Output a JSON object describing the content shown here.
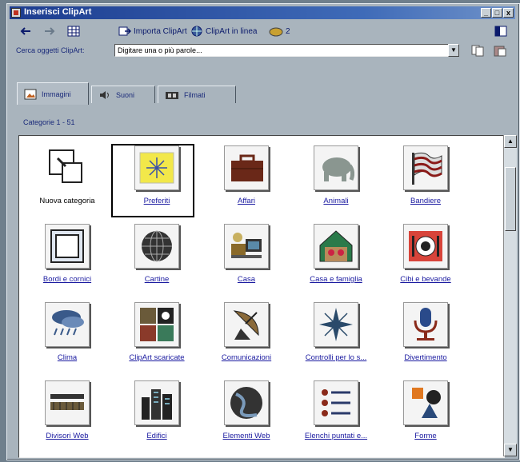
{
  "window": {
    "title": "Inserisci ClipArt",
    "controls": [
      "_",
      "□",
      "x"
    ]
  },
  "toolbar": {
    "importa": "Importa ClipArt",
    "online": "ClipArt in linea",
    "help": "2"
  },
  "search": {
    "label": "Cerca oggetti ClipArt:",
    "value": "Digitare una o più parole..."
  },
  "tabs": [
    {
      "label": "Immagini",
      "icon": "images-icon"
    },
    {
      "label": "Suoni",
      "icon": "speaker-icon"
    },
    {
      "label": "Filmati",
      "icon": "film-icon"
    }
  ],
  "categories_label": "Categorie 1 - 51",
  "categories": [
    {
      "label": "Nuova categoria",
      "icon": "new-category-icon"
    },
    {
      "label": "Preferiti",
      "icon": "star-icon"
    },
    {
      "label": "Affari",
      "icon": "briefcase-icon"
    },
    {
      "label": "Animali",
      "icon": "elephant-icon"
    },
    {
      "label": "Bandiere",
      "icon": "flag-icon"
    },
    {
      "label": "Bordi e cornici",
      "icon": "frame-icon"
    },
    {
      "label": "Cartine",
      "icon": "globe-icon"
    },
    {
      "label": "Casa",
      "icon": "home-icon"
    },
    {
      "label": "Casa e famiglia",
      "icon": "family-house-icon"
    },
    {
      "label": "Cibi e bevande",
      "icon": "plate-icon"
    },
    {
      "label": "Clima",
      "icon": "weather-icon"
    },
    {
      "label": "ClipArt scaricate",
      "icon": "downloaded-clipart-icon"
    },
    {
      "label": "Comunicazioni",
      "icon": "satellite-dish-icon"
    },
    {
      "label": "Controlli per lo s...",
      "icon": "compass-icon"
    },
    {
      "label": "Divertimento",
      "icon": "microphone-icon"
    },
    {
      "label": "Divisori Web",
      "icon": "divider-icon"
    },
    {
      "label": "Edifici",
      "icon": "buildings-icon"
    },
    {
      "label": "Elementi Web",
      "icon": "web-globe-icon"
    },
    {
      "label": "Elenchi puntati e...",
      "icon": "bullets-icon"
    },
    {
      "label": "Forme",
      "icon": "shapes-icon"
    }
  ]
}
